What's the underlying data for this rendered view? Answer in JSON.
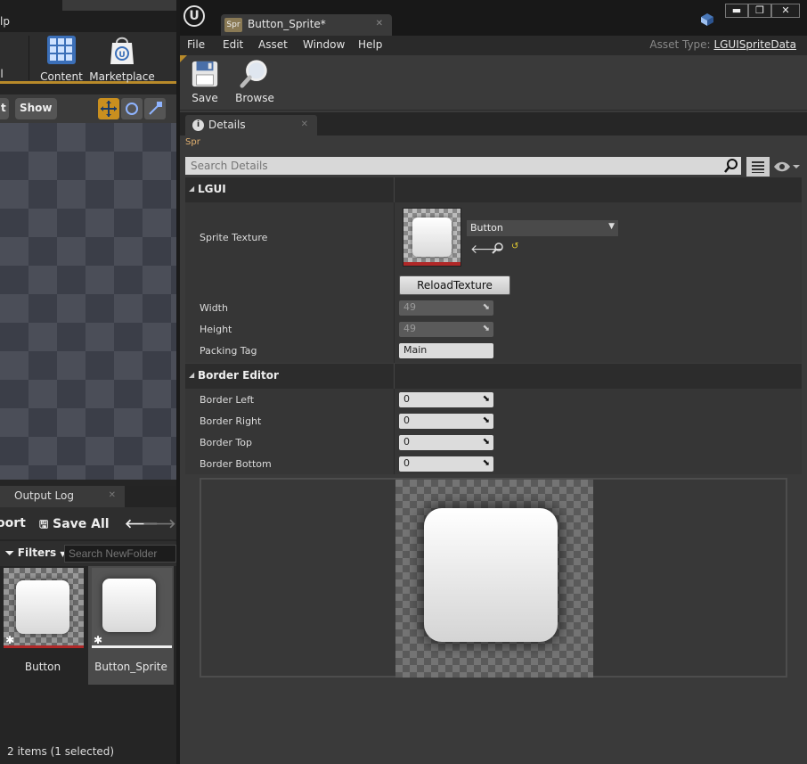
{
  "background_editor": {
    "help_menu_fragment": "lp",
    "toolbar": {
      "content_label": "Content",
      "marketplace_label": "Marketplace",
      "partial_label": "l"
    },
    "viewport_buttons": {
      "partial": "t",
      "show": "Show"
    },
    "output_log_tab": "Output Log",
    "content_browser": {
      "import_fragment": "oort",
      "save_all": "Save All",
      "filters": "Filters",
      "search_placeholder": "Search NewFolder",
      "assets": [
        {
          "name": "Button",
          "bar_color": "#b02828"
        },
        {
          "name": "Button_Sprite",
          "bar_color": "#f0f0f0"
        }
      ],
      "status": "2 items (1 selected)"
    }
  },
  "window": {
    "tab_badge": "Spr",
    "tab_title": "Button_Sprite*",
    "min": "▬",
    "max": "❐",
    "close": "✕",
    "menu": [
      "File",
      "Edit",
      "Asset",
      "Window",
      "Help"
    ],
    "asset_type_label": "Asset Type:",
    "asset_type_value": "LGUISpriteData",
    "toolbar": {
      "save": "Save",
      "browse": "Browse"
    },
    "details_tab": "Details",
    "spr_label": "Spr",
    "search_placeholder": "Search Details",
    "lgui_category": "LGUI",
    "sprite_texture_label": "Sprite Texture",
    "texture_value": "Button",
    "reload_button": "ReloadTexture",
    "width_label": "Width",
    "width_value": "49",
    "height_label": "Height",
    "height_value": "49",
    "packing_label": "Packing Tag",
    "packing_value": "Main",
    "border_category": "Border Editor",
    "borders": [
      {
        "label": "Border Left",
        "value": "0"
      },
      {
        "label": "Border Right",
        "value": "0"
      },
      {
        "label": "Border Top",
        "value": "0"
      },
      {
        "label": "Border Bottom",
        "value": "0"
      }
    ]
  }
}
